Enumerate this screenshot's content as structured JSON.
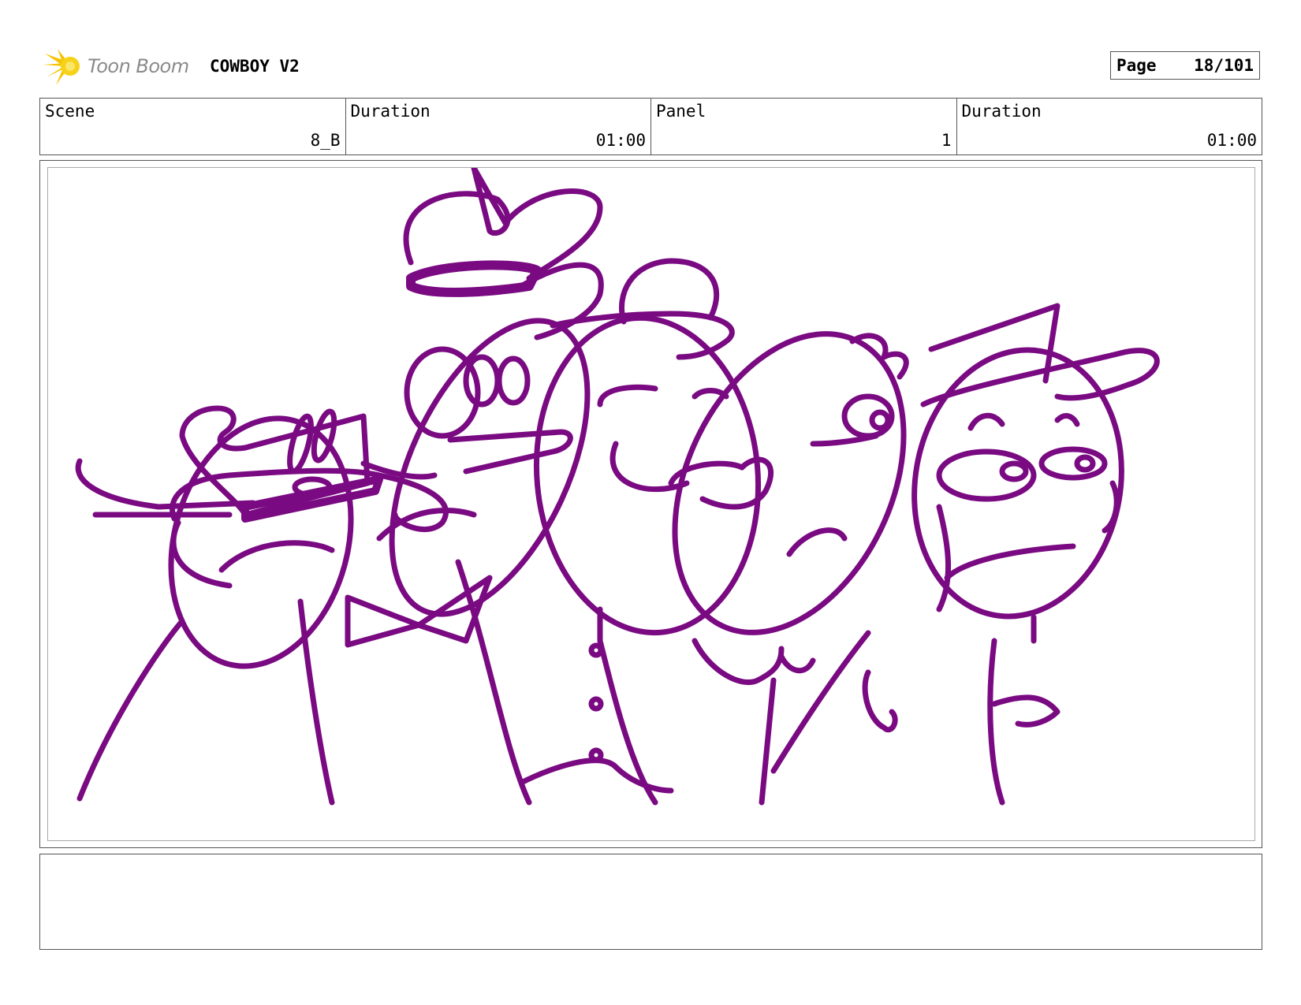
{
  "header": {
    "logo_text": "Toon Boom",
    "project_title": "COWBOY V2",
    "page_label": "Page",
    "page_value": "18/101"
  },
  "info": {
    "scene_label": "Scene",
    "scene_value": "8_B",
    "scene_duration_label": "Duration",
    "scene_duration_value": "01:00",
    "panel_label": "Panel",
    "panel_value": "1",
    "panel_duration_label": "Duration",
    "panel_duration_value": "01:00"
  },
  "notes": {
    "text": ""
  },
  "colors": {
    "sketch": "#7a0a82",
    "logo_accent": "#f5c400",
    "border": "#555555"
  },
  "icons": {
    "logo": "toon-boom-star-icon"
  }
}
